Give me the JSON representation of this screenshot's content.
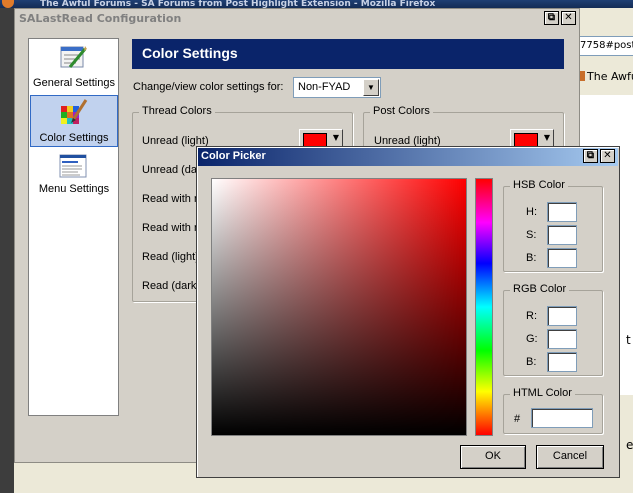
{
  "background": {
    "browser_title": "The Awful Forums - SA Forums from Post Highlight Extension - Mozilla Firefox",
    "address_fragment": "7758#post",
    "tab_fragment": "The Awful",
    "fragment_1": "t",
    "fragment_2": "e"
  },
  "config_window": {
    "title": "SALastRead Configuration",
    "restore_glyph": "⧉",
    "close_glyph": "✕",
    "sidebar": [
      {
        "label": "General Settings",
        "icon": "general-settings-icon",
        "selected": false
      },
      {
        "label": "Color Settings",
        "icon": "color-settings-icon",
        "selected": true
      },
      {
        "label": "Menu Settings",
        "icon": "menu-settings-icon",
        "selected": false
      }
    ],
    "header": "Color Settings",
    "change_label": "Change/view color settings for:",
    "forum_select": {
      "value": "Non-FYAD",
      "arrow": "▼"
    },
    "thread_colors": {
      "title": "Thread Colors",
      "rows": [
        "Unread (light)",
        "Unread (da",
        "Read with r",
        "Read with r",
        "Read (light)",
        "Read (dark"
      ]
    },
    "post_colors": {
      "title": "Post Colors",
      "rows": [
        "Unread (light)"
      ]
    },
    "swatch_color": "#ff0000"
  },
  "picker": {
    "title": "Color Picker",
    "restore_glyph": "⧉",
    "close_glyph": "✕",
    "hsb": {
      "title": "HSB Color",
      "labels": [
        "H:",
        "S:",
        "B:"
      ]
    },
    "rgb": {
      "title": "RGB Color",
      "labels": [
        "R:",
        "G:",
        "B:"
      ]
    },
    "html": {
      "title": "HTML Color",
      "prefix": "#"
    },
    "ok_label": "OK",
    "cancel_label": "Cancel"
  }
}
